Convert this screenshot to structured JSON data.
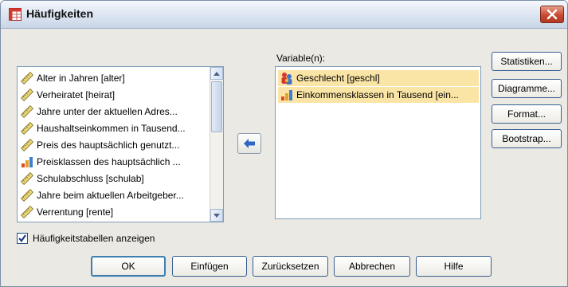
{
  "window": {
    "title": "Häufigkeiten",
    "title_icon": "frequencies-table-icon",
    "close_icon": "close-icon"
  },
  "source_list": {
    "items": [
      {
        "label": "Alter in Jahren [alter]",
        "icon": "scale-ruler-icon"
      },
      {
        "label": "Verheiratet [heirat]",
        "icon": "scale-ruler-icon"
      },
      {
        "label": "Jahre unter der aktuellen Adres...",
        "icon": "scale-ruler-icon"
      },
      {
        "label": "Haushaltseinkommen in Tausend...",
        "icon": "scale-ruler-icon"
      },
      {
        "label": "Preis des hauptsächlich genutzt...",
        "icon": "scale-ruler-icon"
      },
      {
        "label": "Preisklassen des hauptsächlich ...",
        "icon": "ordinal-bars-icon"
      },
      {
        "label": "Schulabschluss [schulab]",
        "icon": "scale-ruler-icon"
      },
      {
        "label": "Jahre beim aktuellen Arbeitgeber...",
        "icon": "scale-ruler-icon"
      },
      {
        "label": "Verrentung [rente]",
        "icon": "scale-ruler-icon"
      }
    ]
  },
  "target": {
    "label": "Variable(n):",
    "items": [
      {
        "label": "Geschlecht [geschl]",
        "icon": "nominal-people-icon"
      },
      {
        "label": "Einkommensklassen in Tausend [ein...",
        "icon": "ordinal-bars-icon"
      }
    ]
  },
  "move_button": {
    "icon": "arrow-left-icon"
  },
  "side_buttons": {
    "statistiken": "Statistiken...",
    "diagramme": "Diagramme...",
    "format": "Format...",
    "bootstrap": "Bootstrap..."
  },
  "checkbox": {
    "label": "Häufigkeitstabellen anzeigen",
    "checked": true
  },
  "bottom_buttons": {
    "ok": "OK",
    "einfuegen": "Einfügen",
    "zuruecksetzen": "Zurücksetzen",
    "abbrechen": "Abbrechen",
    "hilfe": "Hilfe"
  },
  "colors": {
    "dialog_bg": "#eae9e3",
    "selection": "#fbe5a6",
    "accent": "#3b5f92"
  }
}
